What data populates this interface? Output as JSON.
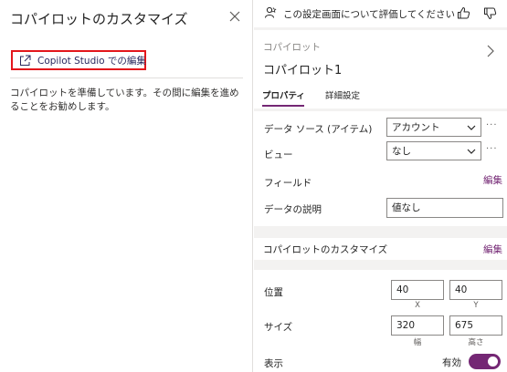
{
  "left_pane": {
    "title": "コパイロットのカスタマイズ",
    "edit_link_label": "Copilot Studio での編集",
    "description": "コパイロットを準備しています。その間に編集を進めることをお勧めします。"
  },
  "right_pane": {
    "feedback": {
      "text": "この設定画面について評価してください"
    },
    "header": {
      "type_label": "コパイロット",
      "name": "コパイロット1",
      "tabs": [
        {
          "label": "プロパティ",
          "active": true
        },
        {
          "label": "詳細設定",
          "active": false
        }
      ]
    },
    "properties": {
      "data_source": {
        "label": "データ ソース (アイテム)",
        "value": "アカウント"
      },
      "view": {
        "label": "ビュー",
        "value": "なし"
      },
      "fields": {
        "label": "フィールド",
        "action": "編集"
      },
      "data_description": {
        "label": "データの説明",
        "value": "値なし"
      },
      "more_label": "···"
    },
    "customize": {
      "label": "コパイロットのカスタマイズ",
      "action": "編集"
    },
    "layout": {
      "position": {
        "label": "位置",
        "x": "40",
        "y": "40",
        "x_caption": "X",
        "y_caption": "Y"
      },
      "size": {
        "label": "サイズ",
        "width": "320",
        "height": "675",
        "width_caption": "幅",
        "height_caption": "高さ"
      },
      "visible": {
        "label": "表示",
        "toggle_label": "有効",
        "on": true
      }
    }
  },
  "colors": {
    "accent": "#742774",
    "highlight_border": "#e3161c",
    "panel_bg": "#f3f2f1"
  }
}
